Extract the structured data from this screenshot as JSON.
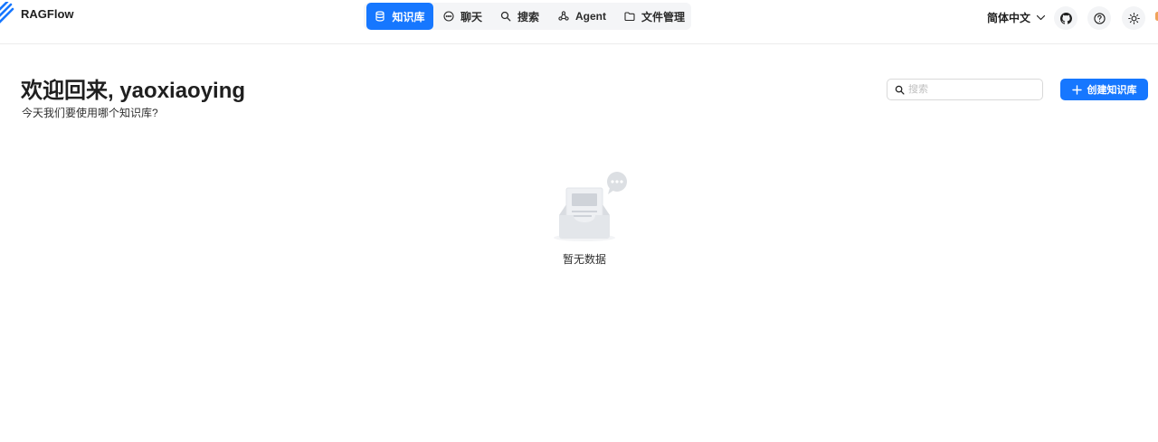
{
  "app": {
    "name": "RAGFlow"
  },
  "nav": {
    "items": [
      {
        "label": "知识库",
        "icon": "database-icon",
        "active": true
      },
      {
        "label": "聊天",
        "icon": "chat-bubble-icon",
        "active": false
      },
      {
        "label": "搜索",
        "icon": "search-icon",
        "active": false
      },
      {
        "label": "Agent",
        "icon": "agent-graph-icon",
        "active": false
      },
      {
        "label": "文件管理",
        "icon": "folder-icon",
        "active": false
      }
    ]
  },
  "header": {
    "language": "简体中文",
    "icons": [
      "github-icon",
      "help-circle-icon",
      "sun-icon"
    ]
  },
  "main": {
    "title": "欢迎回来, yaoxiaoying",
    "subtitle": "今天我们要使用哪个知识库?",
    "search_placeholder": "搜索",
    "create_label": "创建知识库",
    "empty_text": "暂无数据"
  },
  "colors": {
    "primary": "#1677ff",
    "nav_bg": "#f4f5f7"
  }
}
